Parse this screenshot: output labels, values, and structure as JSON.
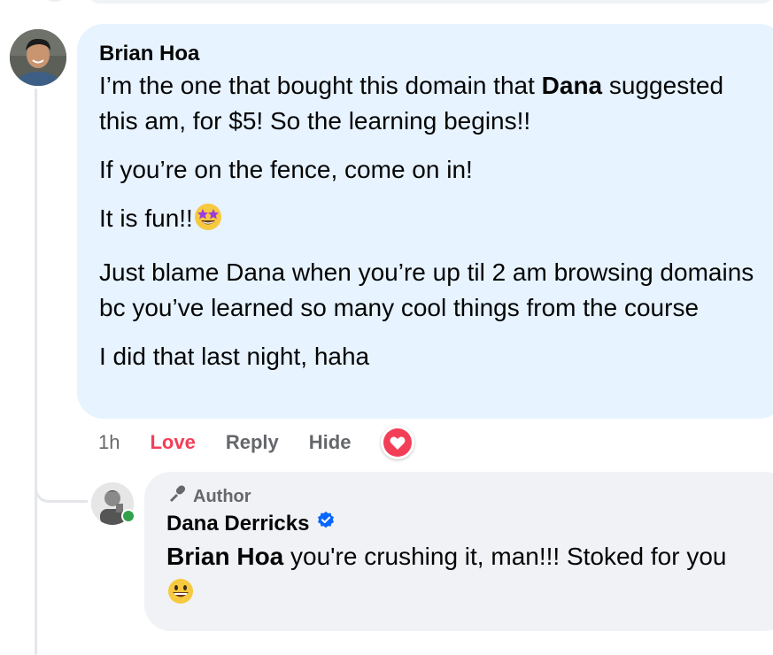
{
  "comment": {
    "author": "Brian Hoa",
    "paragraphs": {
      "p1_before": "I’m the one that bought this domain that ",
      "p1_mention": "Dana",
      "p1_after": " suggested this am, for $5! So the learning begins!!",
      "p2": "If you’re on the fence, come on in!",
      "p3": "It is fun!!",
      "p4": "Just blame Dana when you’re up til 2 am browsing domains bc you’ve learned so many cool things from the course",
      "p5": "I did that last night, haha"
    },
    "emoji_p3": "star-struck-emoji",
    "actions": {
      "time": "1h",
      "love": "Love",
      "reply": "Reply",
      "hide": "Hide"
    },
    "reaction_icon": "heart-icon"
  },
  "reply": {
    "tag": "Author",
    "author": "Dana Derricks",
    "verified_icon": "verified-badge-icon",
    "mention": "Brian Hoa",
    "text": " you're crushing it, man!!! Stoked for you ",
    "emoji": "grinning-emoji"
  },
  "colors": {
    "main_bubble": "#e7f3ff",
    "reply_bubble": "#f0f2f5",
    "love": "#f33e58",
    "verified": "#0866ff",
    "online": "#31a24c"
  }
}
